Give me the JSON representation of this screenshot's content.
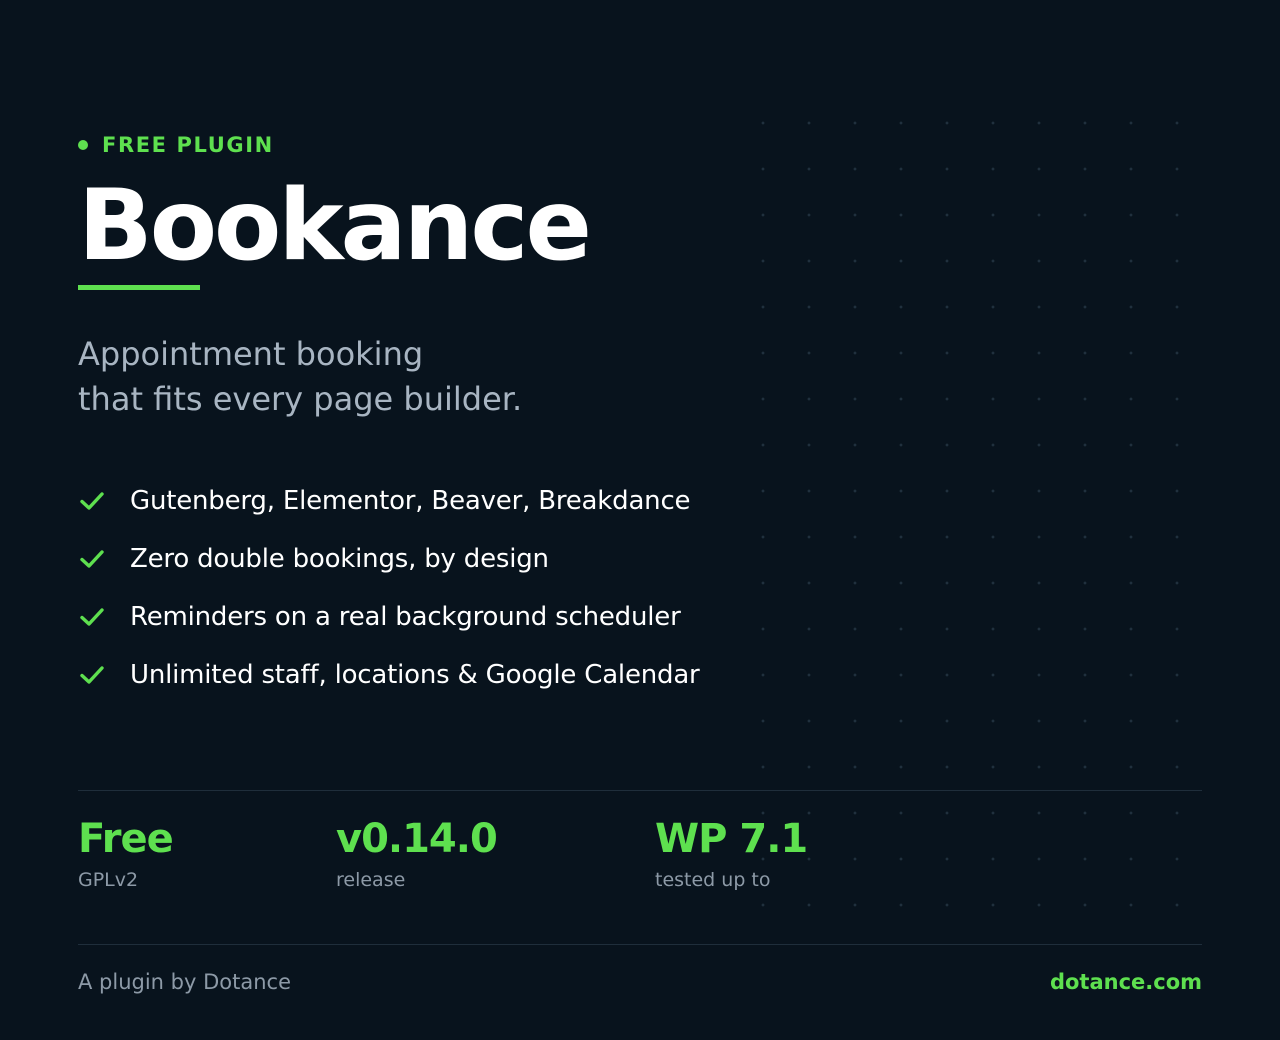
{
  "colors": {
    "background": "#08131d",
    "accent": "#5ee04f",
    "muted_text": "#8d9aa7",
    "subtitle_text": "#a8b5c2"
  },
  "eyebrow": {
    "label": "FREE PLUGIN"
  },
  "title": "Bookance",
  "subtitle": {
    "line1": "Appointment booking",
    "line2": "that fits every page builder."
  },
  "features": [
    {
      "icon": "check-icon",
      "label": "Gutenberg, Elementor, Beaver, Breakdance"
    },
    {
      "icon": "check-icon",
      "label": "Zero double bookings, by design"
    },
    {
      "icon": "check-icon",
      "label": "Reminders on a real background scheduler"
    },
    {
      "icon": "check-icon",
      "label": "Unlimited staff, locations & Google Calendar"
    }
  ],
  "stats": [
    {
      "value": "Free",
      "label": "GPLv2"
    },
    {
      "value": "v0.14.0",
      "label": "release"
    },
    {
      "value": "WP 7.1",
      "label": "tested up to"
    }
  ],
  "footer": {
    "credit": "A plugin by Dotance",
    "link": "dotance.com"
  }
}
